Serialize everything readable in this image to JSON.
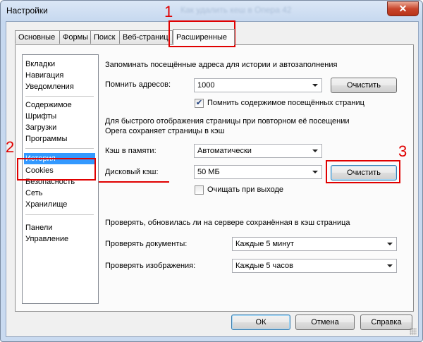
{
  "window": {
    "title": "Настройки",
    "title_blurred": "Как удалить кеш в Опера 42",
    "close_label": "✕"
  },
  "tabs": [
    {
      "label": "Основные"
    },
    {
      "label": "Формы"
    },
    {
      "label": "Поиск"
    },
    {
      "label": "Веб-страниц"
    },
    {
      "label": "Расширенные"
    }
  ],
  "sidebar": {
    "groups": [
      [
        "Вкладки",
        "Навигация",
        "Уведомления"
      ],
      [
        "Содержимое",
        "Шрифты",
        "Загрузки",
        "Программы"
      ],
      [
        "История",
        "Cookies",
        "Безопасность",
        "Сеть",
        "Хранилище"
      ],
      [
        "Панели",
        "Управление"
      ]
    ],
    "selected": "История"
  },
  "history": {
    "heading": "Запоминать посещённые адреса для истории и автозаполнения",
    "remember_label": "Помнить адресов:",
    "remember_value": "1000",
    "clear_label": "Очистить",
    "remember_content_label": "Помнить содержимое посещённых страниц",
    "remember_content_checked": true
  },
  "cache": {
    "heading_line1": "Для быстрого отображения страницы при повторном её посещении",
    "heading_line2": "Opera сохраняет страницы в кэш",
    "memory_label": "Кэш в памяти:",
    "memory_value": "Автоматически",
    "disk_label": "Дисковый кэш:",
    "disk_value": "50 МБ",
    "clear_label": "Очистить",
    "clear_on_exit_label": "Очищать при выходе",
    "clear_on_exit_checked": false
  },
  "check": {
    "heading": "Проверять, обновилась ли на сервере сохранённая в кэш страница",
    "documents_label": "Проверять документы:",
    "documents_value": "Каждые 5 минут",
    "images_label": "Проверять изображения:",
    "images_value": "Каждые 5 часов"
  },
  "footer": {
    "ok": "ОК",
    "cancel": "Отмена",
    "help": "Справка"
  },
  "annotations": {
    "n1": "1",
    "n2": "2",
    "n3": "3",
    "color": "#e00000"
  }
}
